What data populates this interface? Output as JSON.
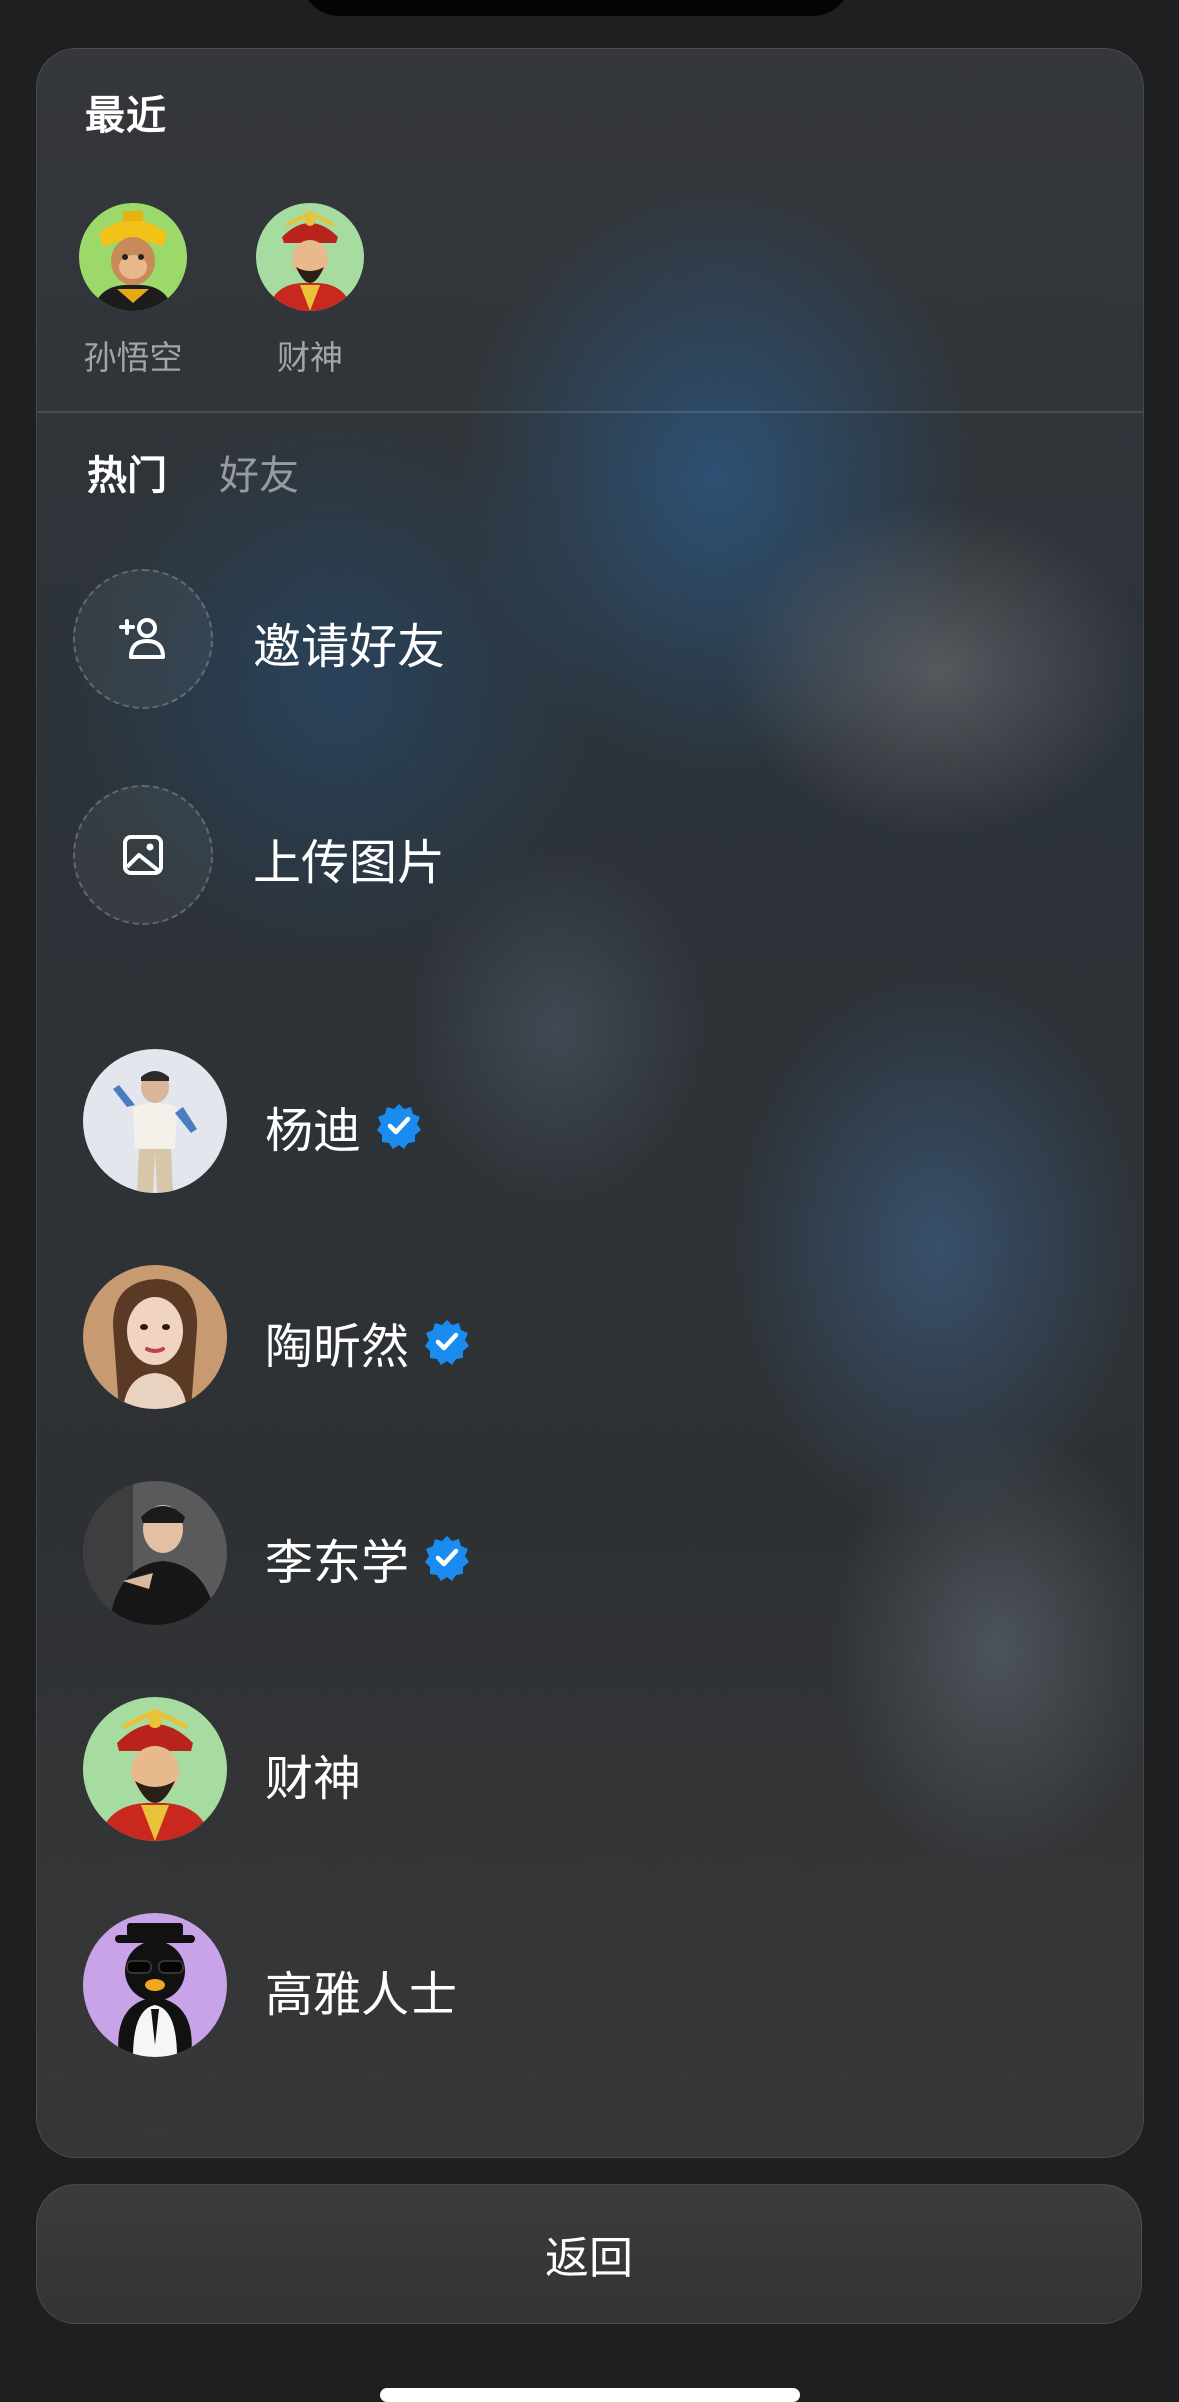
{
  "recent": {
    "title": "最近",
    "items": [
      {
        "name": "孙悟空",
        "avatar": "monkey-king-avatar"
      },
      {
        "name": "财神",
        "avatar": "god-of-wealth-avatar"
      }
    ]
  },
  "tabs": [
    {
      "label": "热门",
      "active": true
    },
    {
      "label": "好友",
      "active": false
    }
  ],
  "actions": [
    {
      "label": "邀请好友",
      "icon": "add-person-icon"
    },
    {
      "label": "上传图片",
      "icon": "image-icon"
    }
  ],
  "users": [
    {
      "name": "杨迪",
      "verified": true,
      "avatar": "man-white-vest-avatar"
    },
    {
      "name": "陶昕然",
      "verified": true,
      "avatar": "woman-portrait-avatar"
    },
    {
      "name": "李东学",
      "verified": true,
      "avatar": "man-dark-suit-avatar"
    },
    {
      "name": "财神",
      "verified": false,
      "avatar": "god-of-wealth-avatar"
    },
    {
      "name": "高雅人士",
      "verified": false,
      "avatar": "penguin-sunglasses-avatar"
    }
  ],
  "back_button": {
    "label": "返回"
  },
  "colors": {
    "verified": "#1a8cf0",
    "page_background": "#1e1f21"
  }
}
